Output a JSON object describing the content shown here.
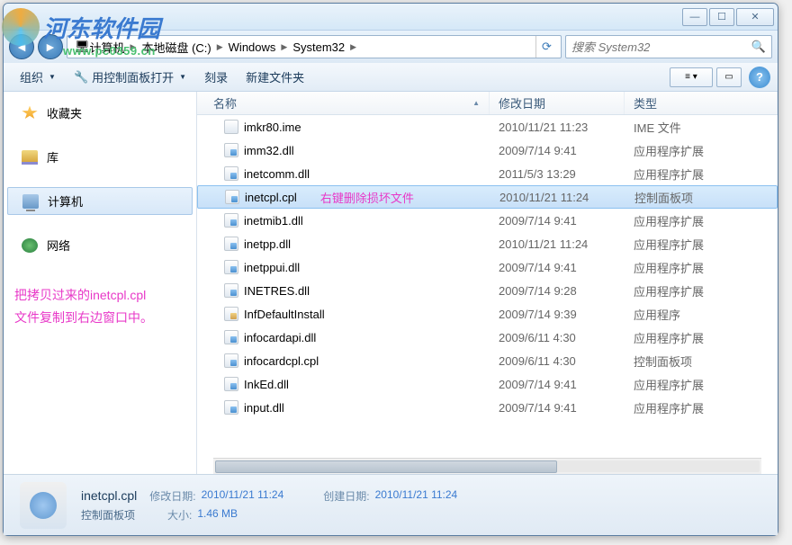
{
  "watermark": {
    "text": "河东软件园",
    "url": "www.pc0359.cn"
  },
  "breadcrumb": {
    "segments": [
      "计算机",
      "本地磁盘 (C:)",
      "Windows",
      "System32"
    ]
  },
  "search": {
    "placeholder": "搜索 System32"
  },
  "toolbar": {
    "organize": "组织",
    "open": "用控制面板打开",
    "burn": "刻录",
    "newfolder": "新建文件夹"
  },
  "sidebar": {
    "favorites": "收藏夹",
    "libraries": "库",
    "computer": "计算机",
    "network": "网络"
  },
  "annotationLeft": {
    "l1": "把拷贝过来的inetcpl.cpl",
    "l2": "文件复制到右边窗口中。"
  },
  "columns": {
    "name": "名称",
    "date": "修改日期",
    "type": "类型"
  },
  "rowAnnot": "右键删除损坏文件",
  "files": [
    {
      "name": "imkr80.ime",
      "date": "2010/11/21 11:23",
      "type": "IME 文件",
      "icon": "ime"
    },
    {
      "name": "imm32.dll",
      "date": "2009/7/14 9:41",
      "type": "应用程序扩展",
      "icon": "dll"
    },
    {
      "name": "inetcomm.dll",
      "date": "2011/5/3 13:29",
      "type": "应用程序扩展",
      "icon": "dll"
    },
    {
      "name": "inetcpl.cpl",
      "date": "2010/11/21 11:24",
      "type": "控制面板项",
      "icon": "cpl",
      "selected": true,
      "annot": true
    },
    {
      "name": "inetmib1.dll",
      "date": "2009/7/14 9:41",
      "type": "应用程序扩展",
      "icon": "dll"
    },
    {
      "name": "inetpp.dll",
      "date": "2010/11/21 11:24",
      "type": "应用程序扩展",
      "icon": "dll"
    },
    {
      "name": "inetppui.dll",
      "date": "2009/7/14 9:41",
      "type": "应用程序扩展",
      "icon": "dll"
    },
    {
      "name": "INETRES.dll",
      "date": "2009/7/14 9:28",
      "type": "应用程序扩展",
      "icon": "dll"
    },
    {
      "name": "InfDefaultInstall",
      "date": "2009/7/14 9:39",
      "type": "应用程序",
      "icon": "exe"
    },
    {
      "name": "infocardapi.dll",
      "date": "2009/6/11 4:30",
      "type": "应用程序扩展",
      "icon": "dll"
    },
    {
      "name": "infocardcpl.cpl",
      "date": "2009/6/11 4:30",
      "type": "控制面板项",
      "icon": "cpl"
    },
    {
      "name": "InkEd.dll",
      "date": "2009/7/14 9:41",
      "type": "应用程序扩展",
      "icon": "dll"
    },
    {
      "name": "input.dll",
      "date": "2009/7/14 9:41",
      "type": "应用程序扩展",
      "icon": "dll"
    }
  ],
  "details": {
    "name": "inetcpl.cpl",
    "typeLabel": "控制面板项",
    "modLabel": "修改日期:",
    "modVal": "2010/11/21 11:24",
    "createLabel": "创建日期:",
    "createVal": "2010/11/21 11:24",
    "sizeLabel": "大小:",
    "sizeVal": "1.46 MB"
  }
}
